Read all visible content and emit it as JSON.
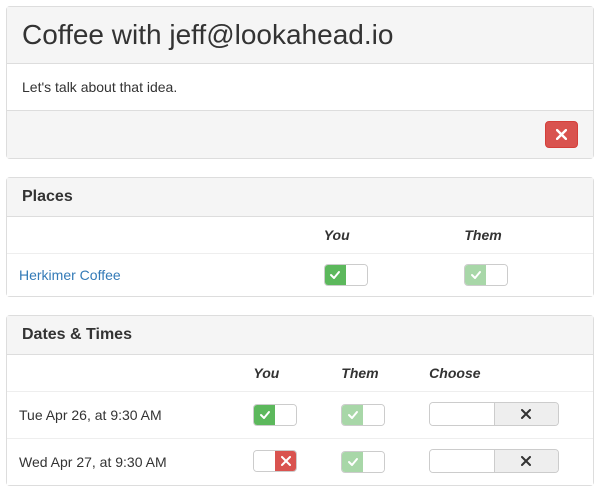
{
  "header": {
    "title": "Coffee with jeff@lookahead.io",
    "description": "Let's talk about that idea."
  },
  "places": {
    "title": "Places",
    "columns": {
      "name": "",
      "you": "You",
      "them": "Them"
    },
    "rows": [
      {
        "name": "Herkimer Coffee",
        "you": "checked",
        "them": "checked-faded"
      }
    ]
  },
  "dates": {
    "title": "Dates & Times",
    "columns": {
      "name": "",
      "you": "You",
      "them": "Them",
      "choose": "Choose"
    },
    "rows": [
      {
        "name": "Tue Apr 26, at 9:30 AM",
        "you": "checked",
        "them": "checked-faded",
        "choose": "x"
      },
      {
        "name": "Wed Apr 27, at 9:30 AM",
        "you": "x-red",
        "them": "checked-faded",
        "choose": "x"
      }
    ]
  }
}
